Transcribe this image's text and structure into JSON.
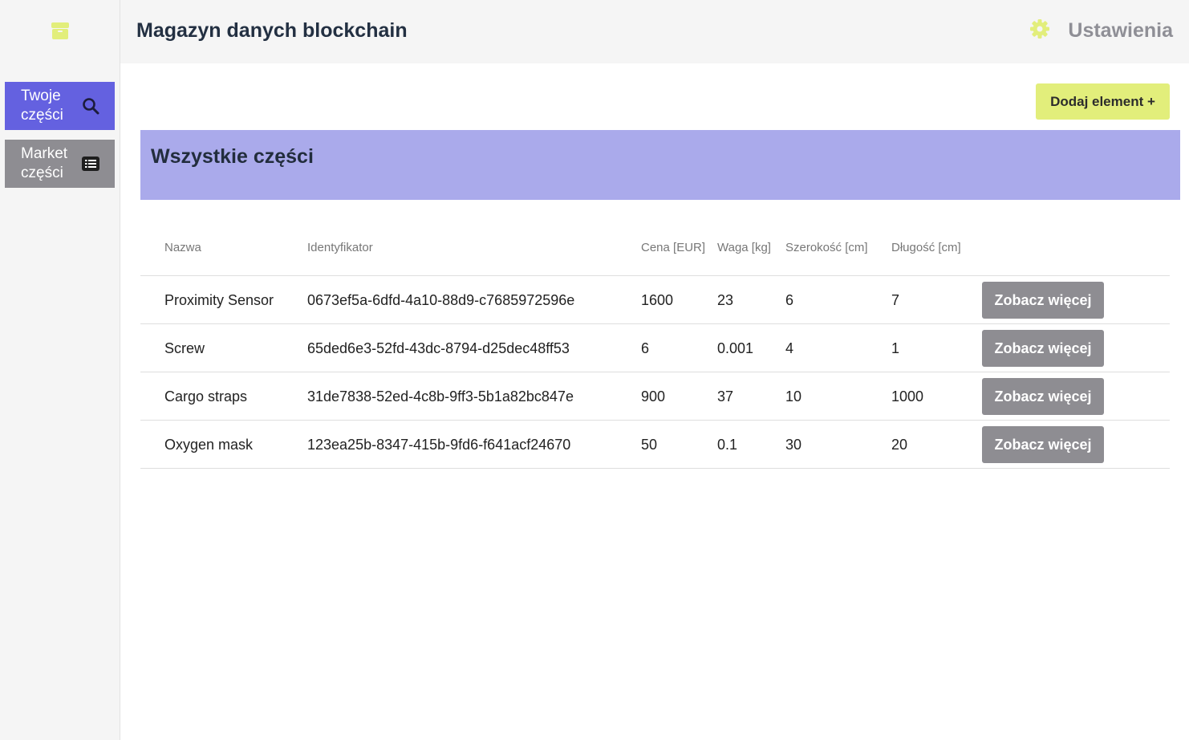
{
  "colors": {
    "accent": "#6461e0",
    "sidebar_inactive": "#8e8d92",
    "banner": "#aaaaeb",
    "add_button": "#e2ee7b",
    "logo": "#e2ee7b"
  },
  "sidebar": {
    "logo_icon": "box-icon",
    "items": [
      {
        "label": "Twoje części",
        "icon": "search-icon",
        "active": true
      },
      {
        "label": "Market części",
        "icon": "list-icon",
        "active": false
      }
    ]
  },
  "header": {
    "title": "Magazyn danych blockchain",
    "settings_label": "Ustawienia",
    "settings_icon": "gear-icon"
  },
  "main": {
    "add_button_label": "Dodaj element +",
    "section_title": "Wszystkie części",
    "table": {
      "columns": [
        "Nazwa",
        "Identyfikator",
        "Cena [EUR]",
        "Waga [kg]",
        "Szerokość [cm]",
        "Długość [cm]"
      ],
      "rows": [
        {
          "name": "Proximity Sensor",
          "id": "0673ef5a-6dfd-4a10-88d9-c7685972596e",
          "price": "1600",
          "weight": "23",
          "width": "6",
          "length": "7",
          "action": "Zobacz więcej"
        },
        {
          "name": "Screw",
          "id": "65ded6e3-52fd-43dc-8794-d25dec48ff53",
          "price": "6",
          "weight": "0.001",
          "width": "4",
          "length": "1",
          "action": "Zobacz więcej"
        },
        {
          "name": "Cargo straps",
          "id": "31de7838-52ed-4c8b-9ff3-5b1a82bc847e",
          "price": "900",
          "weight": "37",
          "width": "10",
          "length": "1000",
          "action": "Zobacz więcej"
        },
        {
          "name": "Oxygen mask",
          "id": "123ea25b-8347-415b-9fd6-f641acf24670",
          "price": "50",
          "weight": "0.1",
          "width": "30",
          "length": "20",
          "action": "Zobacz więcej"
        }
      ]
    }
  }
}
